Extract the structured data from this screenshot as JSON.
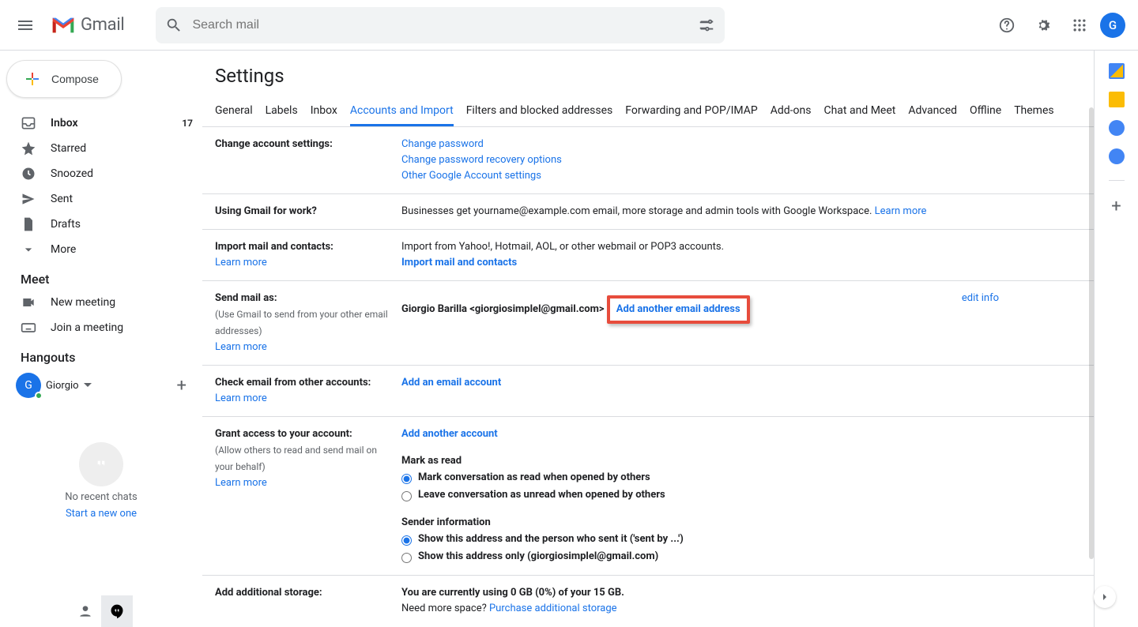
{
  "header": {
    "product": "Gmail",
    "search_placeholder": "Search mail",
    "avatar_letter": "G"
  },
  "sidebar": {
    "compose": "Compose",
    "items": [
      {
        "icon": "inbox",
        "label": "Inbox",
        "count": "17",
        "bold": true
      },
      {
        "icon": "star",
        "label": "Starred"
      },
      {
        "icon": "clock",
        "label": "Snoozed"
      },
      {
        "icon": "send",
        "label": "Sent"
      },
      {
        "icon": "file",
        "label": "Drafts"
      },
      {
        "icon": "expand",
        "label": "More"
      }
    ],
    "meet_title": "Meet",
    "meet_items": [
      {
        "icon": "camera",
        "label": "New meeting"
      },
      {
        "icon": "keyboard",
        "label": "Join a meeting"
      }
    ],
    "hangouts_title": "Hangouts",
    "hangouts_user": "Giorgio",
    "chat_empty": "No recent chats",
    "chat_cta": "Start a new one"
  },
  "page": {
    "title": "Settings",
    "tabs": [
      "General",
      "Labels",
      "Inbox",
      "Accounts and Import",
      "Filters and blocked addresses",
      "Forwarding and POP/IMAP",
      "Add-ons",
      "Chat and Meet",
      "Advanced",
      "Offline",
      "Themes"
    ],
    "active_tab": "Accounts and Import"
  },
  "rows": {
    "change": {
      "label": "Change account settings:",
      "links": [
        "Change password",
        "Change password recovery options",
        "Other Google Account settings"
      ]
    },
    "work": {
      "label": "Using Gmail for work?",
      "text": "Businesses get yourname@example.com email, more storage and admin tools with Google Workspace. ",
      "learn": "Learn more"
    },
    "import": {
      "label": "Import mail and contacts:",
      "learn": "Learn more",
      "text": "Import from Yahoo!, Hotmail, AOL, or other webmail or POP3 accounts.",
      "action": "Import mail and contacts"
    },
    "sendas": {
      "label": "Send mail as:",
      "sub": "(Use Gmail to send from your other email addresses)",
      "learn": "Learn more",
      "identity": "Giorgio Barilla <giorgiosimplel@gmail.com>",
      "add": "Add another email address",
      "edit": "edit info"
    },
    "check": {
      "label": "Check email from other accounts:",
      "learn": "Learn more",
      "action": "Add an email account"
    },
    "grant": {
      "label": "Grant access to your account:",
      "sub": "(Allow others to read and send mail on your behalf)",
      "learn": "Learn more",
      "action": "Add another account",
      "mark_title": "Mark as read",
      "mark_opt1": "Mark conversation as read when opened by others",
      "mark_opt2": "Leave conversation as unread when opened by others",
      "sender_title": "Sender information",
      "sender_opt1": "Show this address and the person who sent it ('sent by ...')",
      "sender_opt2": "Show this address only (giorgiosimplel@gmail.com)"
    },
    "storage": {
      "label": "Add additional storage:",
      "line1": "You are currently using 0 GB (0%) of your 15 GB.",
      "line2": "Need more space? ",
      "link": "Purchase additional storage"
    }
  },
  "sidepanel": {
    "apps": [
      "calendar",
      "keep",
      "tasks",
      "contacts"
    ]
  }
}
